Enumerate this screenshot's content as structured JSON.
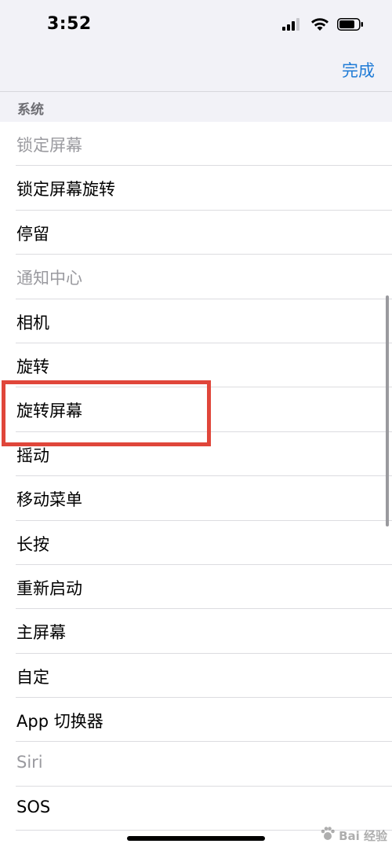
{
  "status_bar": {
    "time": "3:52"
  },
  "nav": {
    "done_label": "完成"
  },
  "section": {
    "title": "系统"
  },
  "list": {
    "items": [
      {
        "label": "锁定屏幕",
        "disabled": true
      },
      {
        "label": "锁定屏幕旋转",
        "disabled": false
      },
      {
        "label": "停留",
        "disabled": false
      },
      {
        "label": "通知中心",
        "disabled": true
      },
      {
        "label": "相机",
        "disabled": false
      },
      {
        "label": "旋转",
        "disabled": false
      },
      {
        "label": "旋转屏幕",
        "disabled": false
      },
      {
        "label": "摇动",
        "disabled": false
      },
      {
        "label": "移动菜单",
        "disabled": false
      },
      {
        "label": "长按",
        "disabled": false
      },
      {
        "label": "重新启动",
        "disabled": false
      },
      {
        "label": "主屏幕",
        "disabled": false
      },
      {
        "label": "自定",
        "disabled": false
      },
      {
        "label": "App 切换器",
        "disabled": false
      },
      {
        "label": "Siri",
        "disabled": true
      },
      {
        "label": "SOS",
        "disabled": false
      }
    ]
  },
  "colors": {
    "accent": "#1f7bd6",
    "highlight": "#e0463a",
    "disabled_text": "#9a9a9f"
  },
  "icons": [
    "signal-icon",
    "wifi-icon",
    "battery-icon"
  ],
  "watermark": {
    "text": "Bai 经验"
  }
}
